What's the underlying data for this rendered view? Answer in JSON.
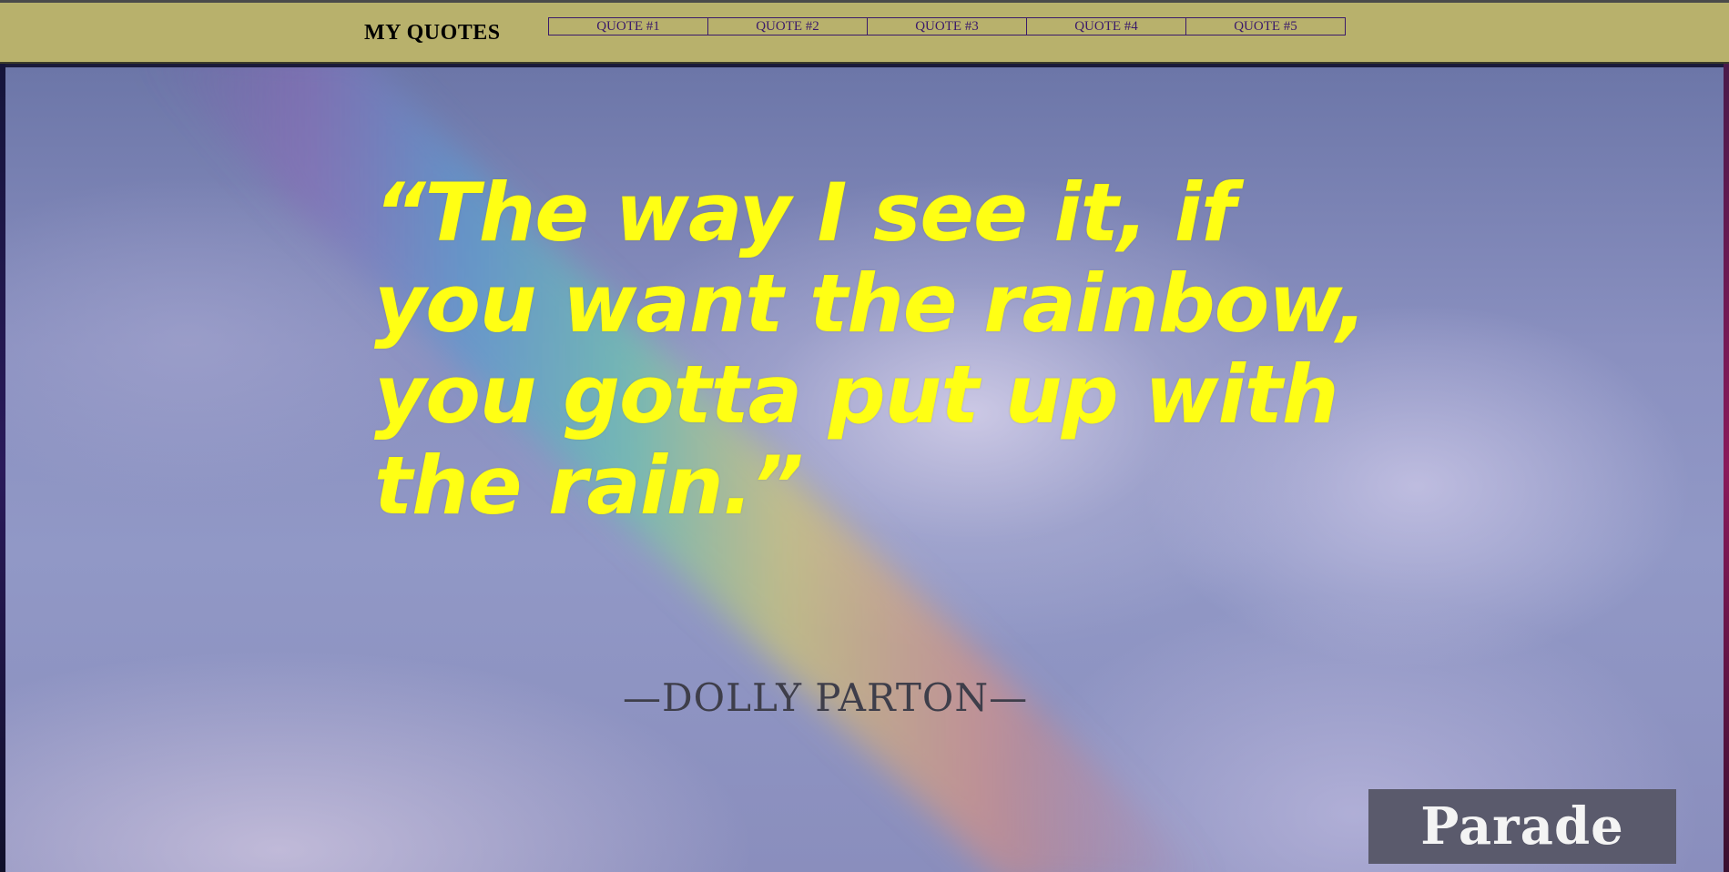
{
  "header": {
    "title": "MY QUOTES",
    "nav": [
      {
        "label": "QUOTE #1"
      },
      {
        "label": "QUOTE #2"
      },
      {
        "label": "QUOTE #3"
      },
      {
        "label": "QUOTE #4"
      },
      {
        "label": "QUOTE #5"
      }
    ]
  },
  "hero": {
    "quote": "“The way I see it, if you want the rainbow, you gotta put up with the rain.”",
    "author": "—DOLLY PARTON—",
    "watermark": "Parade"
  },
  "colors": {
    "header_bg": "#b8b16c",
    "nav_border": "#3a1a6a",
    "quote_text": "#ffff14",
    "sky": "#8a90c0"
  }
}
